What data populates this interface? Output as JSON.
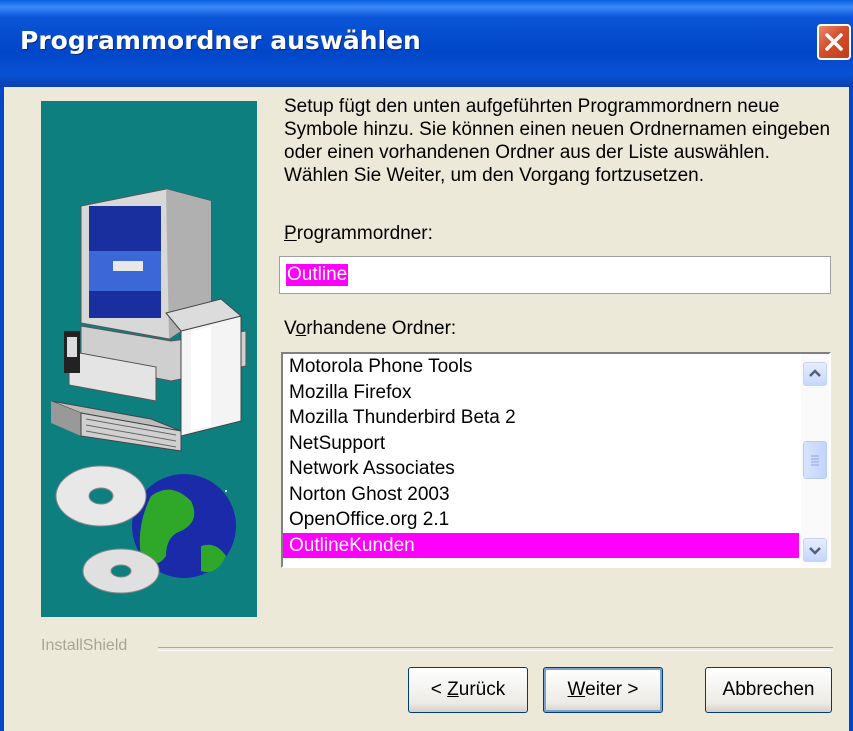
{
  "window": {
    "title": "Programmordner auswählen"
  },
  "description": "Setup fügt den unten aufgeführten Programmordnern neue Symbole hinzu. Sie können einen neuen Ordnernamen eingeben oder einen vorhandenen Ordner aus der Liste auswählen. Wählen Sie Weiter, um den Vorgang fortzusetzen.",
  "folder": {
    "label_accel": "P",
    "label_rest": "rogrammordner:",
    "value": "Outline"
  },
  "existing": {
    "label_pre": "V",
    "label_accel": "o",
    "label_rest": "rhandene Ordner:",
    "items": [
      "Motorola Phone Tools",
      "Mozilla Firefox",
      "Mozilla Thunderbird Beta 2",
      "NetSupport",
      "Network Associates",
      "Norton Ghost 2003",
      "OpenOffice.org 2.1",
      "OutlineKunden"
    ],
    "selected": "OutlineKunden"
  },
  "footer": {
    "brand": "InstallShield"
  },
  "buttons": {
    "back_prefix": "< ",
    "back_accel": "Z",
    "back_rest": "urück",
    "next_accel": "W",
    "next_rest": "eiter >",
    "cancel": "Abbrechen"
  },
  "colors": {
    "titlebar": "#0046c8",
    "selection": "#ff00ff",
    "art_bg": "#0e7f7f",
    "dialog_bg": "#ece9d8"
  },
  "icons": [
    "close-icon",
    "computer-illustration",
    "cd-icon",
    "globe-icon",
    "scroll-up-icon",
    "scroll-down-icon",
    "scroll-thumb-grip-icon"
  ]
}
